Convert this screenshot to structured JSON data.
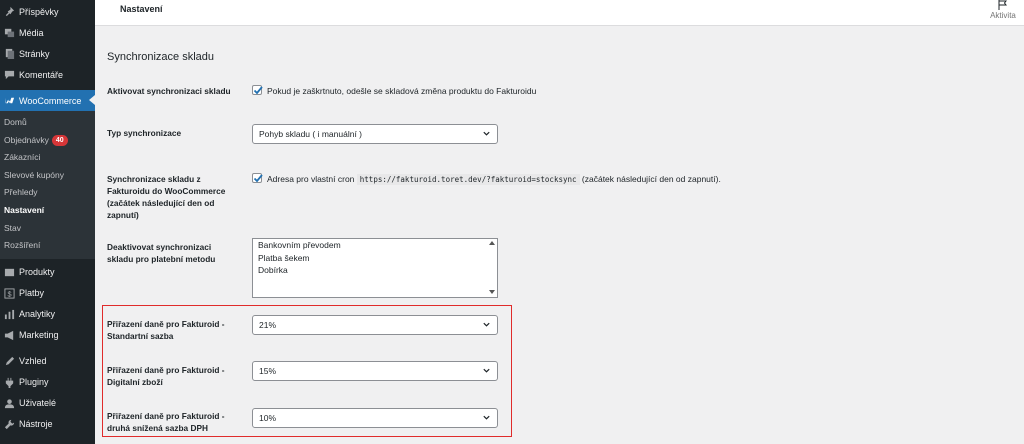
{
  "sidebar": {
    "items_top": [
      {
        "label": "Příspěvky",
        "icon": "pin-icon"
      },
      {
        "label": "Média",
        "icon": "media-icon"
      },
      {
        "label": "Stránky",
        "icon": "pages-icon"
      },
      {
        "label": "Komentáře",
        "icon": "comments-icon"
      }
    ],
    "woocommerce": {
      "label": "WooCommerce",
      "icon": "woocommerce-icon"
    },
    "submenu": [
      {
        "label": "Domů"
      },
      {
        "label": "Objednávky",
        "badge": "40"
      },
      {
        "label": "Zákazníci"
      },
      {
        "label": "Slevové kupóny"
      },
      {
        "label": "Přehledy"
      },
      {
        "label": "Nastavení"
      },
      {
        "label": "Stav"
      },
      {
        "label": "Rozšíření"
      }
    ],
    "items_bottom": [
      {
        "label": "Produkty",
        "icon": "products-icon"
      },
      {
        "label": "Platby",
        "icon": "payments-icon"
      },
      {
        "label": "Analytiky",
        "icon": "analytics-icon"
      },
      {
        "label": "Marketing",
        "icon": "marketing-icon"
      },
      {
        "label": "Vzhled",
        "icon": "appearance-icon"
      },
      {
        "label": "Pluginy",
        "icon": "plugins-icon"
      },
      {
        "label": "Uživatelé",
        "icon": "users-icon"
      },
      {
        "label": "Nástroje",
        "icon": "tools-icon"
      }
    ]
  },
  "header": {
    "title": "Nastavení",
    "activity_label": "Aktivita",
    "activity_icon": "flag-icon"
  },
  "settings": {
    "section_title": "Synchronizace skladu",
    "activate": {
      "label": "Aktivovat synchronizaci skladu",
      "description": "Pokud je zaškrtnuto, odešle se skladová změna produktu do Fakturoidu",
      "checked": true
    },
    "sync_type": {
      "label": "Typ synchronizace",
      "value": "Pohyb skladu ( i manuální )"
    },
    "cron": {
      "label": "Synchronizace skladu z Fakturoidu do WooCommerce (začátek následující den od zapnutí)",
      "desc_before": "Adresa pro vlastní cron",
      "url": "https://fakturoid.toret.dev/?fakturoid=stocksync",
      "desc_after": "(začátek následující den od zapnutí).",
      "checked": true
    },
    "payment_methods": {
      "label": "Deaktivovat synchronizaci skladu pro platební metodu",
      "options": [
        "Bankovním převodem",
        "Platba šekem",
        "Dobírka"
      ]
    },
    "tax_standard": {
      "label": "Přiřazení daně pro Fakturoid - Standartní sazba",
      "value": "21%"
    },
    "tax_digital": {
      "label": "Přiřazení daně pro Fakturoid - Digitalní zboží",
      "value": "15%"
    },
    "tax_reduced": {
      "label": "Přiřazení daně pro Fakturoid - druhá snížená sazba DPH",
      "value": "10%"
    }
  },
  "colors": {
    "accent": "#2271b1",
    "highlight": "#e02b2b",
    "sidebar": "#1d2327",
    "badge": "#d63638"
  }
}
